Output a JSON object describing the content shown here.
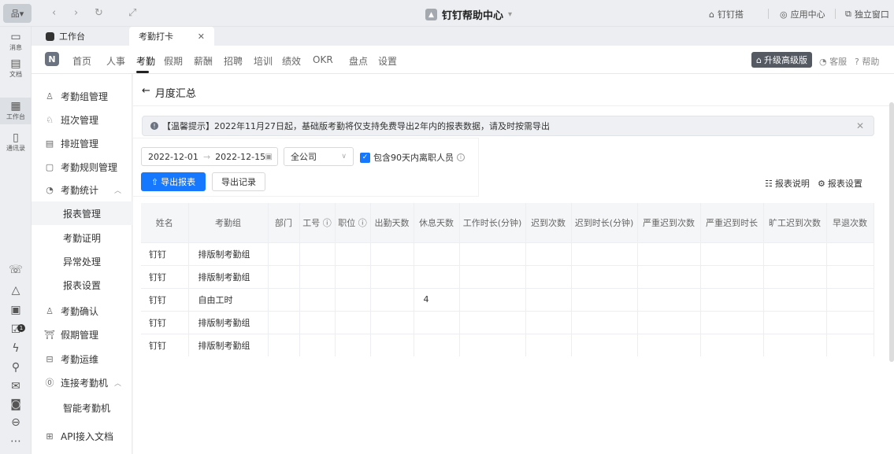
{
  "titlebar": {
    "app_button": "品▾",
    "nav": {
      "back": "‹",
      "forward": "›",
      "refresh": "↻",
      "expand": "⤢"
    },
    "title": "钉钉帮助中心",
    "title_caret": "▾",
    "right_items": [
      "钉钉搭",
      "应用中心",
      "独立窗口"
    ]
  },
  "rail": {
    "items": [
      {
        "label": "消息",
        "icon": "message-icon"
      },
      {
        "label": "文档",
        "icon": "document-icon"
      },
      {
        "label": "工作台",
        "icon": "workbench-icon"
      },
      {
        "label": "通讯录",
        "icon": "contacts-icon"
      }
    ],
    "badge": "1"
  },
  "tabs": [
    {
      "label": "工作台",
      "icon": "workbench-tab-icon"
    },
    {
      "label": "考勤打卡",
      "close": "✕"
    }
  ],
  "appheader": {
    "logo": "N",
    "nav": [
      "首页",
      "人事",
      "考勤",
      "假期",
      "薪酬",
      "招聘",
      "培训",
      "绩效",
      "OKR",
      "盘点",
      "设置"
    ],
    "active_nav": "考勤",
    "upgrade": "升级高级版",
    "service": "客服",
    "help": "帮助"
  },
  "sidebar": {
    "items": [
      {
        "label": "考勤组管理",
        "icon": "group-icon"
      },
      {
        "label": "班次管理",
        "icon": "shift-icon"
      },
      {
        "label": "排班管理",
        "icon": "schedule-icon"
      },
      {
        "label": "考勤规则管理",
        "icon": "rules-icon"
      },
      {
        "label": "考勤统计",
        "icon": "stats-icon",
        "expanded": true
      },
      {
        "label": "报表管理",
        "sub": true,
        "selected": true
      },
      {
        "label": "考勤证明",
        "sub": true
      },
      {
        "label": "异常处理",
        "sub": true
      },
      {
        "label": "报表设置",
        "sub": true
      },
      {
        "label": "考勤确认",
        "icon": "confirm-icon"
      },
      {
        "label": "假期管理",
        "icon": "leave-icon"
      },
      {
        "label": "考勤运维",
        "icon": "ops-icon"
      },
      {
        "label": "连接考勤机",
        "icon": "device-icon",
        "expanded": true
      },
      {
        "label": "智能考勤机",
        "sub": true
      },
      {
        "label": "API接入文档",
        "icon": "api-icon"
      }
    ]
  },
  "main": {
    "back_label": "月度汇总",
    "notice": "【温馨提示】2022年11月27日起，基础版考勤将仅支持免费导出2年内的报表数据，请及时按需导出",
    "date_start": "2022-12-01",
    "date_end": "2022-12-15",
    "company": "全公司",
    "include_resigned": "包含90天内离职人员",
    "export_button": "导出报表",
    "export_record": "导出记录",
    "report_desc": "报表说明",
    "report_settings": "报表设置"
  },
  "table": {
    "columns": [
      "姓名",
      "考勤组",
      "部门",
      "工号",
      "职位",
      "出勤天数",
      "休息天数",
      "工作时长(分钟)",
      "迟到次数",
      "迟到时长(分钟)",
      "严重迟到次数",
      "严重迟到时长",
      "旷工迟到次数",
      "早退次数"
    ],
    "info_columns": [
      3,
      4
    ],
    "rows": [
      [
        "钉钉",
        "排版制考勤组",
        "",
        "",
        "",
        "",
        "",
        "",
        "",
        "",
        "",
        "",
        "",
        ""
      ],
      [
        "钉钉",
        "排版制考勤组",
        "",
        "",
        "",
        "",
        "",
        "",
        "",
        "",
        "",
        "",
        "",
        ""
      ],
      [
        "钉钉",
        "自由工时",
        "",
        "",
        "",
        "",
        "4",
        "",
        "",
        "",
        "",
        "",
        "",
        ""
      ],
      [
        "钉钉",
        "排版制考勤组",
        "",
        "",
        "",
        "",
        "",
        "",
        "",
        "",
        "",
        "",
        "",
        ""
      ],
      [
        "钉钉",
        "排版制考勤组",
        "",
        "",
        "",
        "",
        "",
        "",
        "",
        "",
        "",
        "",
        "",
        ""
      ]
    ]
  },
  "colors": {
    "primary": "#1677ff",
    "upgrade_bg": "#555a62"
  }
}
